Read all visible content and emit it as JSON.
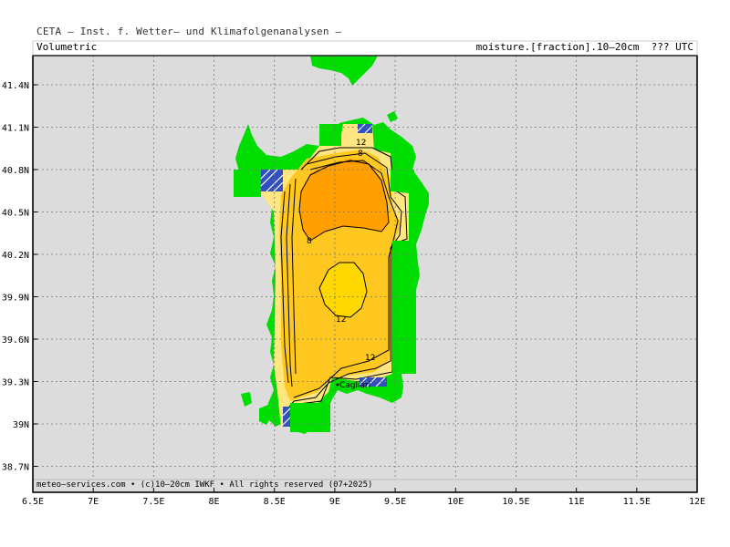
{
  "header": {
    "title": "CETA — Inst. f. Wetter— und Klimafolgenanalysen —"
  },
  "plot": {
    "label_left": "Volumetric",
    "label_right": "moisture.[fraction].10—20cm  ??? UTC",
    "footer": "meteo—services.com • (c)10—20cm IWKF • All rights reserved (07+2025)"
  },
  "axes": {
    "x_ticks": [
      "6.5E",
      "7E",
      "7.5E",
      "8E",
      "8.5E",
      "9E",
      "9.5E",
      "10E",
      "10.5E",
      "11E",
      "11.5E",
      "12E"
    ],
    "y_ticks": [
      "41.4N",
      "41.1N",
      "40.8N",
      "40.5N",
      "40.2N",
      "39.9N",
      "39.6N",
      "39.3N",
      "39N",
      "38.7N"
    ]
  },
  "map": {
    "contour_labels": [
      "12",
      "8",
      "8",
      "12",
      "12"
    ],
    "place_label": "Cagliari",
    "colors": {
      "land": "#00dd00",
      "background": "#dcdcdc",
      "very_dry": "#ff9f00",
      "dry": "#ffbf10",
      "medium": "#ffd800",
      "wet": "#3050c0"
    }
  }
}
